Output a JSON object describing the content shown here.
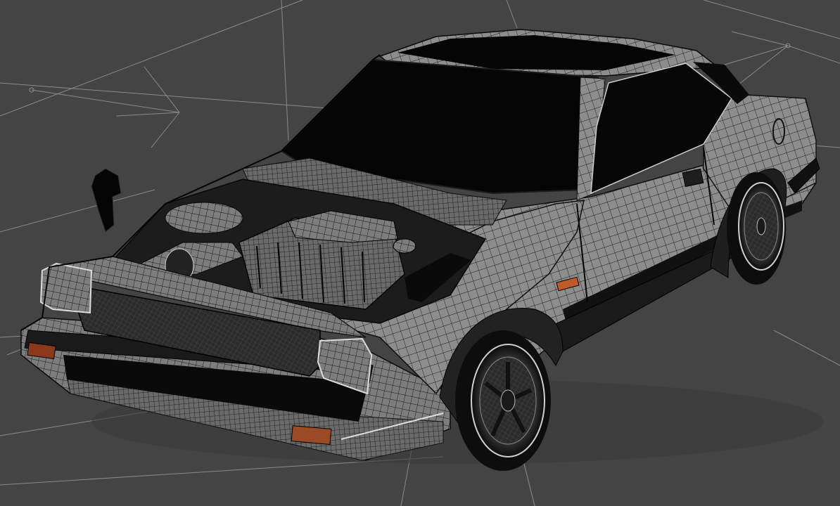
{
  "viewport": {
    "background_color": "#444444",
    "grid_color": "#8a8a8a",
    "mesh_line_color": "#111111",
    "body_fill_color": "#8c8c8c",
    "glass_color": "#050505",
    "indicator_color": "#c05a2a"
  },
  "scene": {
    "object": "wireframe-car-model",
    "camera": "perspective"
  }
}
